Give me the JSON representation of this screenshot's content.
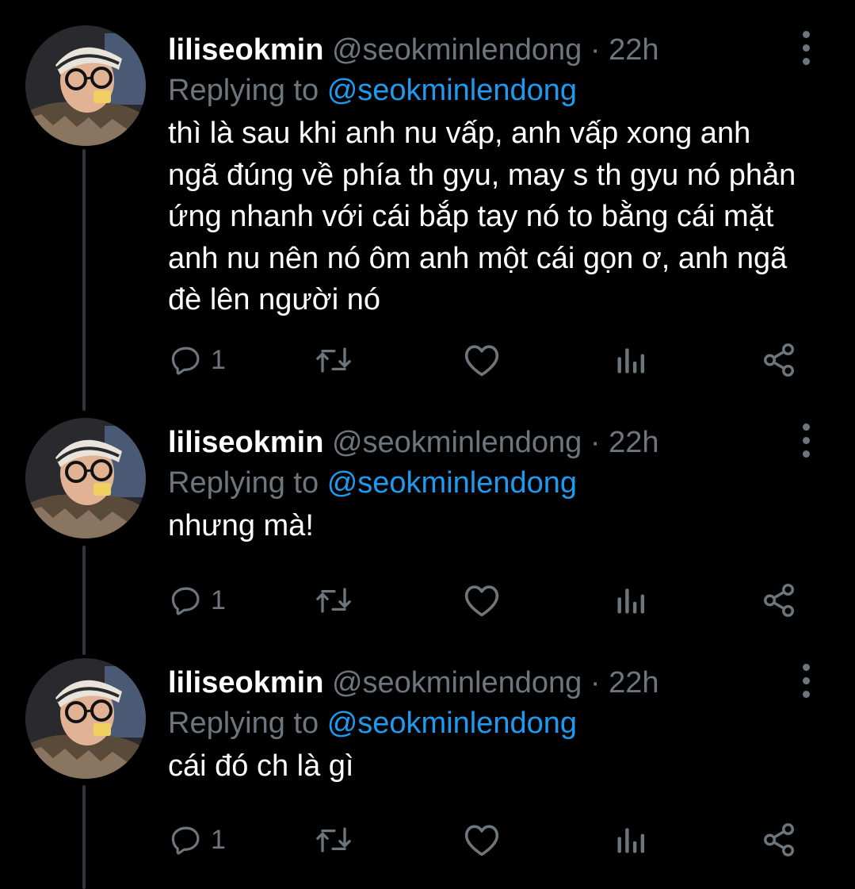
{
  "colors": {
    "background": "#000000",
    "text_primary": "#ffffff",
    "text_secondary": "#6e767d",
    "mention": "#1d9bf0",
    "thread_line": "#333639"
  },
  "tweets": [
    {
      "display_name": "liliseokmin",
      "handle": "@seokminlendong",
      "separator": "·",
      "time": "22h",
      "replying_prefix": "Replying to",
      "replying_to": "@seokminlendong",
      "text": "thì là sau khi anh nu vấp, anh vấp xong anh ngã đúng về phía th gyu, may s th gyu nó phản ứng nhanh với cái bắp tay nó to bằng cái mặt anh nu nên nó ôm anh một cái gọn ơ, anh ngã đè lên người nó",
      "reply_count": "1",
      "icons": [
        "reply-icon",
        "retweet-icon",
        "like-icon",
        "analytics-icon",
        "share-icon",
        "more-icon"
      ]
    },
    {
      "display_name": "liliseokmin",
      "handle": "@seokminlendong",
      "separator": "·",
      "time": "22h",
      "replying_prefix": "Replying to",
      "replying_to": "@seokminlendong",
      "text": "nhưng mà!",
      "reply_count": "1",
      "icons": [
        "reply-icon",
        "retweet-icon",
        "like-icon",
        "analytics-icon",
        "share-icon",
        "more-icon"
      ]
    },
    {
      "display_name": "liliseokmin",
      "handle": "@seokminlendong",
      "separator": "·",
      "time": "22h",
      "replying_prefix": "Replying to",
      "replying_to": "@seokminlendong",
      "text": "cái đó ch là gì",
      "reply_count": "1",
      "icons": [
        "reply-icon",
        "retweet-icon",
        "like-icon",
        "analytics-icon",
        "share-icon",
        "more-icon"
      ]
    }
  ]
}
